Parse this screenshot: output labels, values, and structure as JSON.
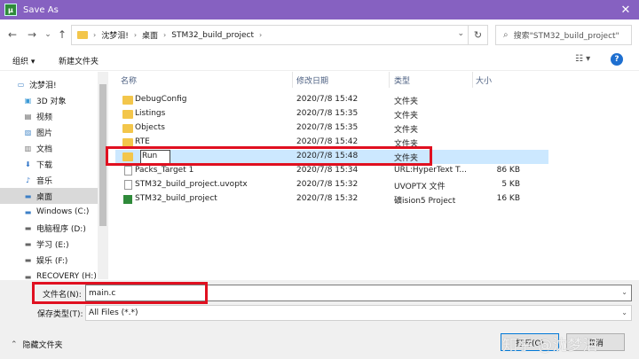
{
  "window": {
    "title": "Save As",
    "app_icon": "µ",
    "close": "✕"
  },
  "nav": {
    "back": "←",
    "forward": "→",
    "dropdown": "⌄",
    "up": "↑"
  },
  "address": {
    "crumbs": [
      "沈梦泪!",
      "桌面",
      "STM32_build_project"
    ],
    "separator": "›",
    "dropdown": "⌄",
    "refresh": "↻"
  },
  "search": {
    "placeholder": "搜索\"STM32_build_project\"",
    "icon": "⌕"
  },
  "toolbar": {
    "organize": "组织 ▾",
    "new_folder": "新建文件夹",
    "view": "☷ ▾",
    "help": "?"
  },
  "sidebar": {
    "items": [
      {
        "label": "沈梦泪!",
        "icon": "computer-icon",
        "glyph": "▭"
      },
      {
        "label": "3D 对象",
        "icon": "cube-icon",
        "glyph": "▣"
      },
      {
        "label": "视频",
        "icon": "video-icon",
        "glyph": "▤"
      },
      {
        "label": "图片",
        "icon": "picture-icon",
        "glyph": "▨"
      },
      {
        "label": "文档",
        "icon": "document-icon",
        "glyph": "▥"
      },
      {
        "label": "下载",
        "icon": "download-icon",
        "glyph": "⬇"
      },
      {
        "label": "音乐",
        "icon": "music-icon",
        "glyph": "♪"
      },
      {
        "label": "桌面",
        "icon": "desktop-icon",
        "glyph": "▬"
      },
      {
        "label": "Windows (C:)",
        "icon": "drive-icon",
        "glyph": "▬"
      },
      {
        "label": "电脑程序 (D:)",
        "icon": "drive-icon",
        "glyph": "▬"
      },
      {
        "label": "学习 (E:)",
        "icon": "drive-icon",
        "glyph": "▬"
      },
      {
        "label": "娱乐 (F:)",
        "icon": "drive-icon",
        "glyph": "▬"
      },
      {
        "label": "RECOVERY (H:)",
        "icon": "drive-icon",
        "glyph": "▬"
      }
    ]
  },
  "columns": {
    "name": "名称",
    "modified": "修改日期",
    "type": "类型",
    "size": "大小",
    "sort_arrow": "^"
  },
  "files": [
    {
      "name": "DebugConfig",
      "modified": "2020/7/8 15:42",
      "type": "文件夹",
      "size": "",
      "icon": "folder"
    },
    {
      "name": "Listings",
      "modified": "2020/7/8 15:35",
      "type": "文件夹",
      "size": "",
      "icon": "folder"
    },
    {
      "name": "Objects",
      "modified": "2020/7/8 15:35",
      "type": "文件夹",
      "size": "",
      "icon": "folder"
    },
    {
      "name": "RTE",
      "modified": "2020/7/8 15:42",
      "type": "文件夹",
      "size": "",
      "icon": "folder"
    },
    {
      "name": "Run",
      "modified": "2020/7/8 15:48",
      "type": "文件夹",
      "size": "",
      "icon": "folder"
    },
    {
      "name": "Packs_Target 1",
      "modified": "2020/7/8 15:34",
      "type": "URL:HyperText T...",
      "size": "86 KB",
      "icon": "doc"
    },
    {
      "name": "STM32_build_project.uvoptx",
      "modified": "2020/7/8 15:32",
      "type": "UVOPTX 文件",
      "size": "5 KB",
      "icon": "doc"
    },
    {
      "name": "STM32_build_project",
      "modified": "2020/7/8 15:32",
      "type": "礦ision5 Project",
      "size": "16 KB",
      "icon": "project"
    }
  ],
  "footer": {
    "filename_label": "文件名(N):",
    "filename_value": "main.c",
    "filetype_label": "保存类型(T):",
    "filetype_value": "All Files (*.*)",
    "hide_folders": "隐藏文件夹",
    "hide_arrow": "⌃",
    "dropdown": "⌄",
    "open_button": "打开(O)",
    "cancel_button": "取消"
  },
  "watermark": "知乎 @沈梦泪",
  "colors": {
    "titlebar": "#8661c1",
    "highlight": "#e01020",
    "selection": "#cce8ff",
    "folder": "#f3c64b"
  }
}
